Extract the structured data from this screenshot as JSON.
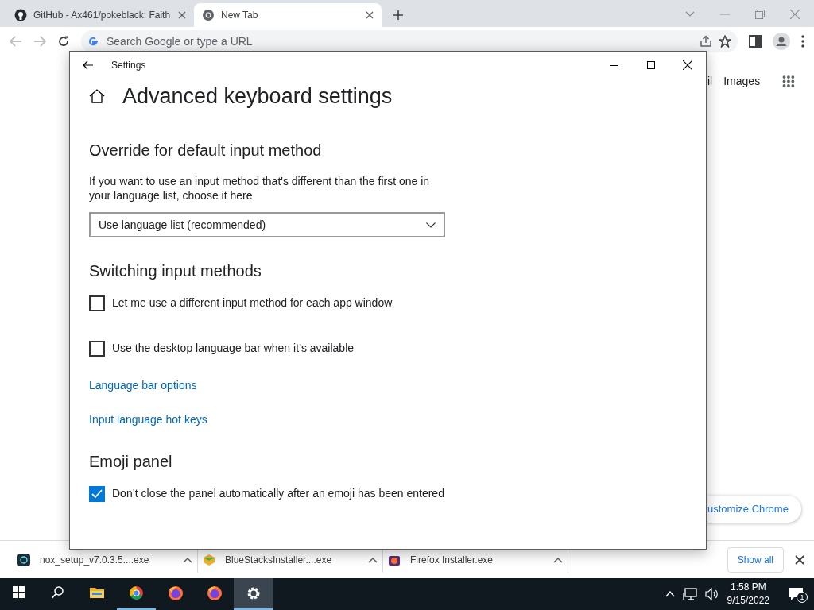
{
  "browser": {
    "tabs": [
      {
        "kind": "github",
        "title": "GitHub - Ax461/pokeblack: Faith",
        "selected": false
      },
      {
        "kind": "chrome",
        "title": "New Tab",
        "selected": true
      }
    ],
    "address": {
      "placeholder": "Search Google or type a URL"
    }
  },
  "page": {
    "links": [
      "il",
      "Images"
    ],
    "customize_button": "ustomize Chrome"
  },
  "settings": {
    "title": "Settings",
    "heading": "Advanced keyboard settings",
    "sections": [
      {
        "heading": "Override for default input method",
        "items": [
          {
            "kind": "text",
            "text": "If you want to use an input method that's different than the first one in your language list, choose it here"
          },
          {
            "kind": "dropdown",
            "value": "Use language list (recommended)"
          }
        ]
      },
      {
        "heading": "Switching input methods",
        "items": [
          {
            "kind": "checkbox",
            "label": "Let me use a different input method for each app window",
            "checked": false
          },
          {
            "kind": "checkbox",
            "label": "Use the desktop language bar when it’s available",
            "checked": false
          },
          {
            "kind": "link",
            "label": "Language bar options"
          },
          {
            "kind": "link",
            "label": "Input language hot keys"
          }
        ]
      },
      {
        "heading": "Emoji panel",
        "items": [
          {
            "kind": "checkbox",
            "label": "Don’t close the panel automatically after an emoji has been entered",
            "checked": true
          }
        ]
      }
    ]
  },
  "downloads": {
    "items": [
      {
        "kind": "nox",
        "name": "nox_setup_v7.0.3.5....exe"
      },
      {
        "kind": "box",
        "name": "BlueStacksInstaller....exe"
      },
      {
        "kind": "fox",
        "name": "Firefox Installer.exe"
      }
    ],
    "show_all": "Show all"
  },
  "taskbar": {
    "apps": [
      {
        "kind": "start",
        "selected": false,
        "running": false
      },
      {
        "kind": "search",
        "selected": false,
        "running": false
      },
      {
        "kind": "folder",
        "selected": false,
        "running": false
      },
      {
        "kind": "chrome",
        "selected": false,
        "running": true
      },
      {
        "kind": "firefox",
        "selected": false,
        "running": false
      },
      {
        "kind": "firefox",
        "selected": false,
        "running": false
      },
      {
        "kind": "settings",
        "selected": true,
        "running": true
      }
    ],
    "time": "1:58 PM",
    "date": "9/15/2022",
    "notifications": "1"
  }
}
